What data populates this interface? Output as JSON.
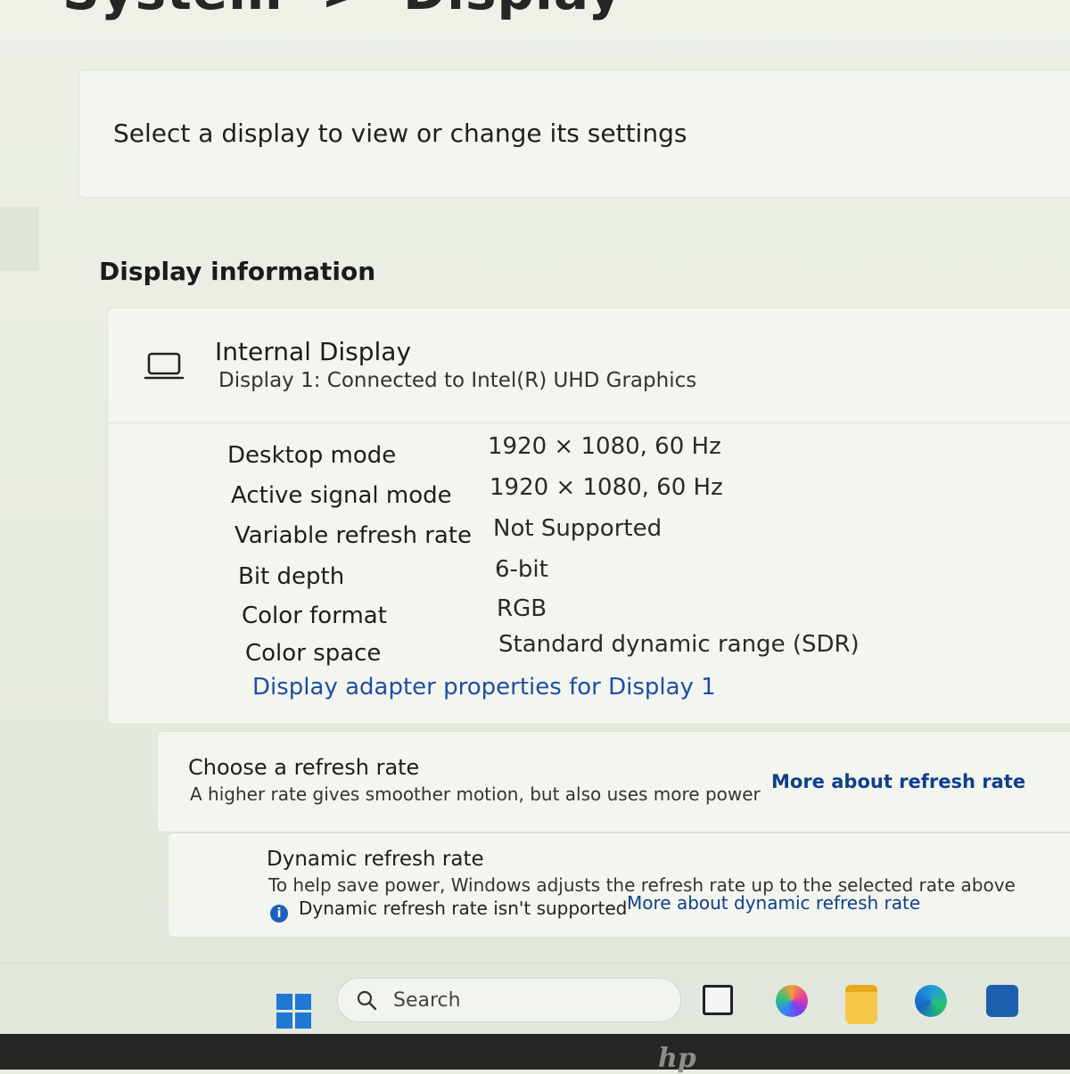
{
  "header": {
    "title_fragment": "System  >  Display"
  },
  "select_display": {
    "text": "Select a display to view or change its settings"
  },
  "display_information": {
    "section_title": "Display information",
    "display_name": "Internal Display",
    "display_subtitle": "Display 1: Connected to Intel(R) UHD Graphics",
    "properties": [
      {
        "label": "Desktop mode",
        "value": "1920 × 1080, 60 Hz"
      },
      {
        "label": "Active signal mode",
        "value": "1920 × 1080, 60 Hz"
      },
      {
        "label": "Variable refresh rate",
        "value": "Not Supported"
      },
      {
        "label": "Bit depth",
        "value": "6-bit"
      },
      {
        "label": "Color format",
        "value": "RGB"
      },
      {
        "label": "Color space",
        "value": "Standard dynamic range (SDR)"
      }
    ],
    "adapter_link": "Display adapter properties for Display 1"
  },
  "refresh_rate": {
    "title": "Choose a refresh rate",
    "description": "A higher rate gives smoother motion, but also uses more power",
    "link": "More about refresh rate"
  },
  "dynamic_refresh": {
    "title": "Dynamic refresh rate",
    "description": "To help save power, Windows adjusts the refresh rate up to the selected rate above",
    "note": "Dynamic refresh rate isn't supported",
    "link": "More about dynamic refresh rate"
  },
  "taskbar": {
    "search_placeholder": "Search",
    "icons": [
      "start-icon",
      "task-view-icon",
      "copilot-icon",
      "file-explorer-icon",
      "edge-icon",
      "store-icon"
    ]
  },
  "device": {
    "logo": "hp"
  }
}
